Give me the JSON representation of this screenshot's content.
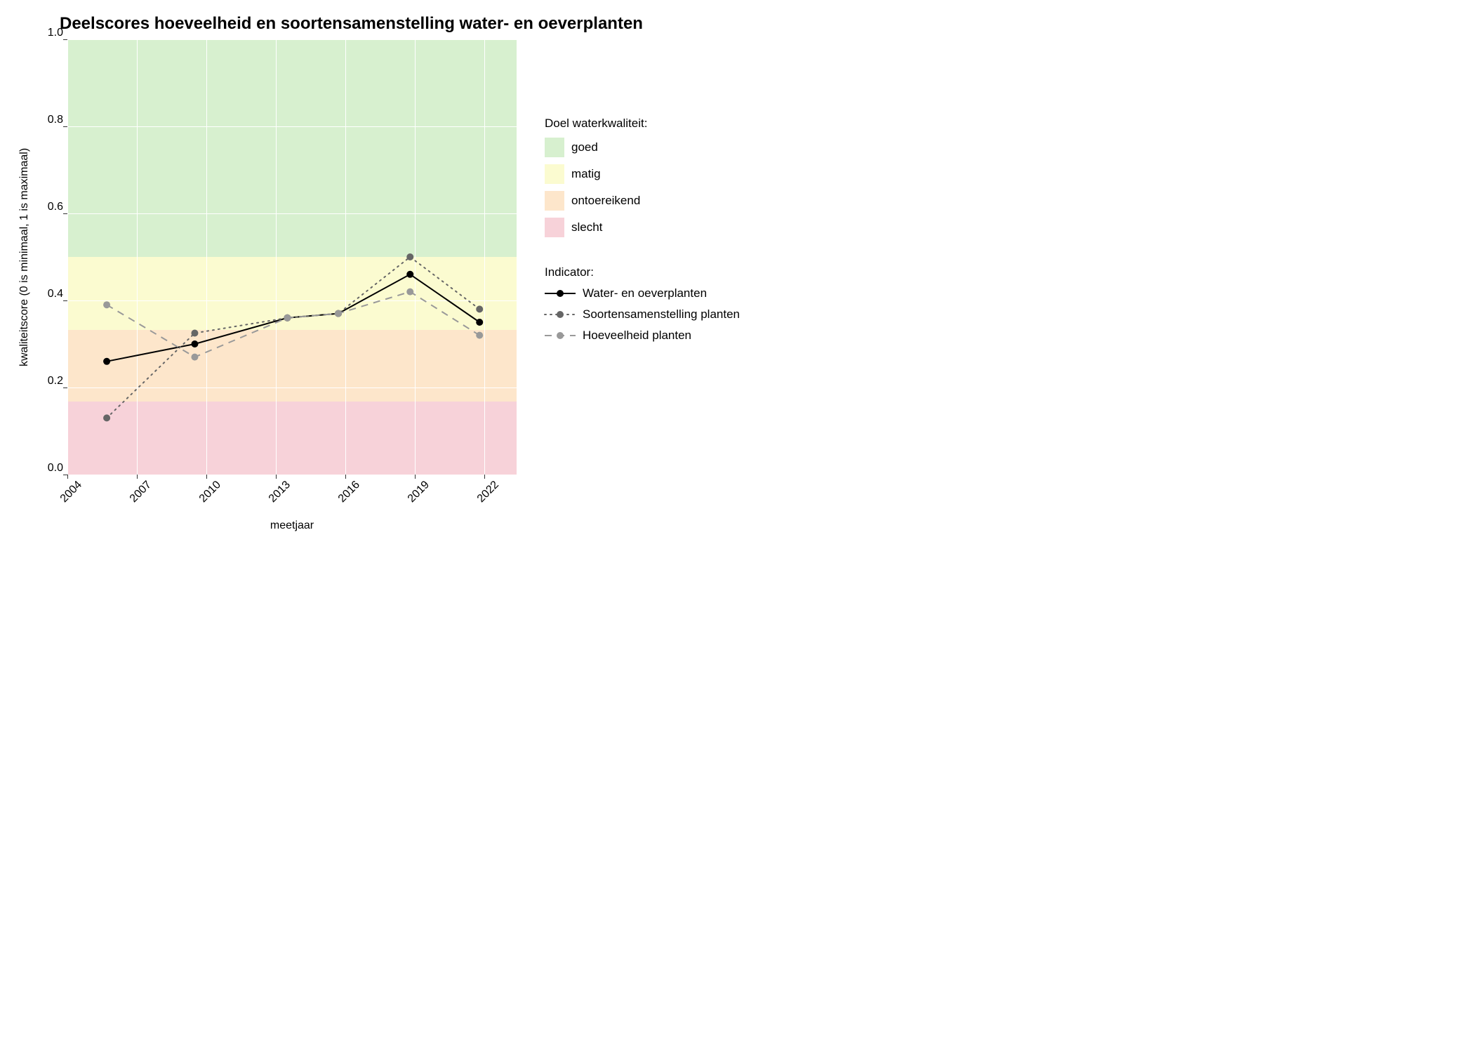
{
  "chart_data": {
    "type": "line",
    "title": "Deelscores hoeveelheid en soortensamenstelling water- en oeverplanten",
    "xlabel": "meetjaar",
    "ylabel": "kwaliteitscore (0 is minimaal, 1 is maximaal)",
    "x_ticks": [
      2004,
      2007,
      2010,
      2013,
      2016,
      2019,
      2022
    ],
    "y_ticks": [
      0.0,
      0.2,
      0.4,
      0.6,
      0.8,
      1.0
    ],
    "xlim": [
      2004,
      2023.4
    ],
    "ylim": [
      0.0,
      1.0
    ],
    "bands": [
      {
        "name": "goed",
        "from": 0.5,
        "to": 1.0,
        "color": "#d7f0cf"
      },
      {
        "name": "matig",
        "from": 0.333,
        "to": 0.5,
        "color": "#fbfbd0"
      },
      {
        "name": "ontoereikend",
        "from": 0.167,
        "to": 0.333,
        "color": "#fde6cb"
      },
      {
        "name": "slecht",
        "from": 0.0,
        "to": 0.167,
        "color": "#f7d2d9"
      }
    ],
    "series": [
      {
        "name": "Water- en oeverplanten",
        "linestyle": "solid",
        "color": "#000000",
        "x": [
          2005.7,
          2009.5,
          2013.5,
          2015.7,
          2018.8,
          2021.8
        ],
        "values": [
          0.26,
          0.3,
          0.36,
          0.37,
          0.46,
          0.35
        ]
      },
      {
        "name": "Soortensamenstelling planten",
        "linestyle": "dotted",
        "color": "#666666",
        "x": [
          2005.7,
          2009.5,
          2013.5,
          2015.7,
          2018.8,
          2021.8
        ],
        "values": [
          0.13,
          0.325,
          0.36,
          0.37,
          0.5,
          0.38
        ]
      },
      {
        "name": "Hoeveelheid planten",
        "linestyle": "dashed",
        "color": "#999999",
        "x": [
          2005.7,
          2009.5,
          2013.5,
          2015.7,
          2018.8,
          2021.8
        ],
        "values": [
          0.39,
          0.27,
          0.36,
          0.37,
          0.42,
          0.32
        ]
      }
    ],
    "legend_quality_title": "Doel waterkwaliteit:",
    "legend_indicator_title": "Indicator:"
  }
}
